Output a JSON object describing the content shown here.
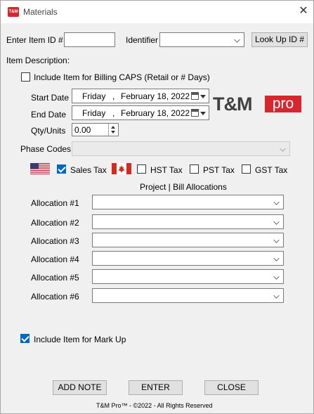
{
  "window": {
    "title": "Materials",
    "app_icon_text": "T&M"
  },
  "lookup": {
    "item_id_label": "Enter Item ID #",
    "item_id_value": "",
    "identifier_label": "Identifier",
    "identifier_value": "",
    "lookup_button": "Look Up ID #"
  },
  "description": {
    "label": "Item Description:",
    "include_billing_caps": "Include Item for Billing CAPS (Retail or # Days)",
    "include_billing_caps_checked": false
  },
  "dates": {
    "start_label": "Start Date",
    "start_day": "Friday",
    "start_sep": ",",
    "start_date": "February  18, 2022",
    "end_label": "End Date",
    "end_day": "Friday",
    "end_sep": ",",
    "end_date": "February  18, 2022"
  },
  "qty": {
    "label": "Qty/Units",
    "value": "0.00"
  },
  "logo": {
    "tm": "T&M",
    "pro": "pro"
  },
  "phase": {
    "label": "Phase Codes",
    "value": ""
  },
  "taxes": {
    "sales_tax": "Sales Tax",
    "sales_tax_checked": true,
    "hst": "HST Tax",
    "hst_checked": false,
    "pst": "PST Tax",
    "pst_checked": false,
    "gst": "GST Tax",
    "gst_checked": false
  },
  "allocations": {
    "heading": "Project | Bill Allocations",
    "items": [
      {
        "label": "Allocation #1",
        "value": ""
      },
      {
        "label": "Allocation #2",
        "value": ""
      },
      {
        "label": "Allocation #3",
        "value": ""
      },
      {
        "label": "Allocation #4",
        "value": ""
      },
      {
        "label": "Allocation #5",
        "value": ""
      },
      {
        "label": "Allocation #6",
        "value": ""
      }
    ]
  },
  "markup": {
    "label": "Include Item for Mark Up",
    "checked": true
  },
  "buttons": {
    "add_note": "ADD NOTE",
    "enter": "ENTER",
    "close": "CLOSE"
  },
  "footer": {
    "copyright": "T&M Pro™ - ©2022 - All Rights Reserved"
  },
  "colors": {
    "brand_red": "#d8262f",
    "check_blue": "#0067c0"
  }
}
